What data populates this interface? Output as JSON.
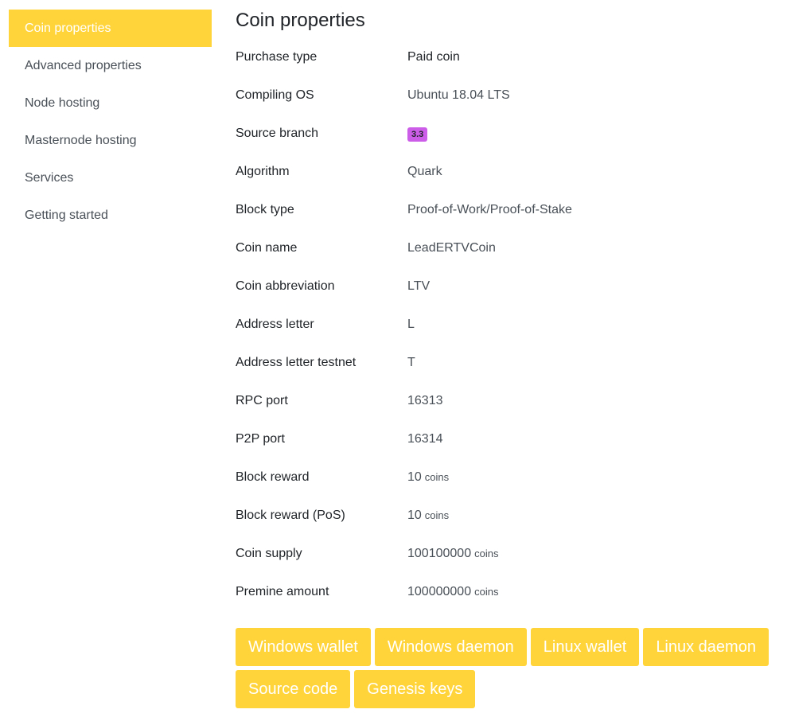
{
  "sidebar": {
    "items": [
      {
        "label": "Coin properties",
        "active": true
      },
      {
        "label": "Advanced properties"
      },
      {
        "label": "Node hosting"
      },
      {
        "label": "Masternode hosting"
      },
      {
        "label": "Services"
      },
      {
        "label": "Getting started"
      }
    ]
  },
  "main": {
    "title": "Coin properties",
    "properties": [
      {
        "label": "Purchase type",
        "value": "Paid coin"
      },
      {
        "label": "Compiling OS",
        "value": "Ubuntu 18.04 LTS"
      },
      {
        "label": "Source branch",
        "badge": "3.3"
      },
      {
        "label": "Algorithm",
        "value": "Quark"
      },
      {
        "label": "Block type",
        "value": "Proof-of-Work/Proof-of-Stake"
      },
      {
        "label": "Coin name",
        "value": "LeadERTVCoin"
      },
      {
        "label": "Coin abbreviation",
        "value": "LTV"
      },
      {
        "label": "Address letter",
        "value": "L"
      },
      {
        "label": "Address letter testnet",
        "value": "T"
      },
      {
        "label": "RPC port",
        "value": "16313"
      },
      {
        "label": "P2P port",
        "value": "16314"
      },
      {
        "label": "Block reward",
        "value": "10",
        "unit": "coins"
      },
      {
        "label": "Block reward (PoS)",
        "value": "10",
        "unit": "coins"
      },
      {
        "label": "Coin supply",
        "value": "100100000",
        "unit": "coins"
      },
      {
        "label": "Premine amount",
        "value": "100000000",
        "unit": "coins"
      }
    ],
    "buttons": [
      {
        "label": "Windows wallet"
      },
      {
        "label": "Windows daemon"
      },
      {
        "label": "Linux wallet"
      },
      {
        "label": "Linux daemon"
      },
      {
        "label": "Source code"
      },
      {
        "label": "Genesis keys"
      }
    ]
  },
  "colors": {
    "accent": "#ffd43b",
    "badge": "#cc5de8",
    "text": "#212529",
    "muted": "#495057"
  }
}
